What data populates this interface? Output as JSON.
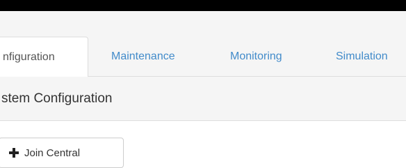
{
  "tabs": [
    {
      "label": "nfiguration",
      "active": true
    },
    {
      "label": "Maintenance",
      "active": false
    },
    {
      "label": "Monitoring",
      "active": false
    },
    {
      "label": "Simulation",
      "active": false
    }
  ],
  "panel": {
    "title": "stem Configuration"
  },
  "actions": {
    "join_central_label": "Join Central",
    "join_central_icon": "plus-icon"
  },
  "colors": {
    "link": "#428bca",
    "active_tab_text": "#555555",
    "top_border": "#000000"
  }
}
